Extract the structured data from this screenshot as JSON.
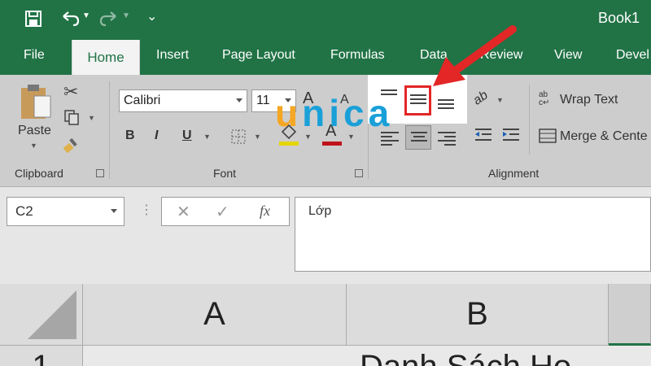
{
  "title_bar": {
    "book_title": "Book1"
  },
  "tabs": [
    "File",
    "Home",
    "Insert",
    "Page Layout",
    "Formulas",
    "Data",
    "Review",
    "View",
    "Devel"
  ],
  "clipboard": {
    "paste_label": "Paste",
    "group_label": "Clipboard"
  },
  "font": {
    "name": "Calibri",
    "size": "11",
    "bold": "B",
    "italic": "I",
    "underline": "U",
    "color_letter": "A",
    "group_label": "Font"
  },
  "alignment": {
    "wrap_text": "Wrap Text",
    "merge_center": "Merge & Cente",
    "group_label": "Alignment",
    "orientation": "ab"
  },
  "formula_row": {
    "name_box": "C2",
    "fx_label": "fx",
    "formula_value": "Lớp"
  },
  "grid": {
    "col_a": "A",
    "col_b": "B",
    "row_1": "1",
    "cell_b1": "Danh Sách Ho"
  },
  "watermark": {
    "logo_orange": "u",
    "logo_rest": "nica"
  },
  "colors": {
    "excel_green": "#217346",
    "highlight_red": "#e32626",
    "watermark_orange": "#f5a623",
    "watermark_blue": "#1aa0d8"
  }
}
